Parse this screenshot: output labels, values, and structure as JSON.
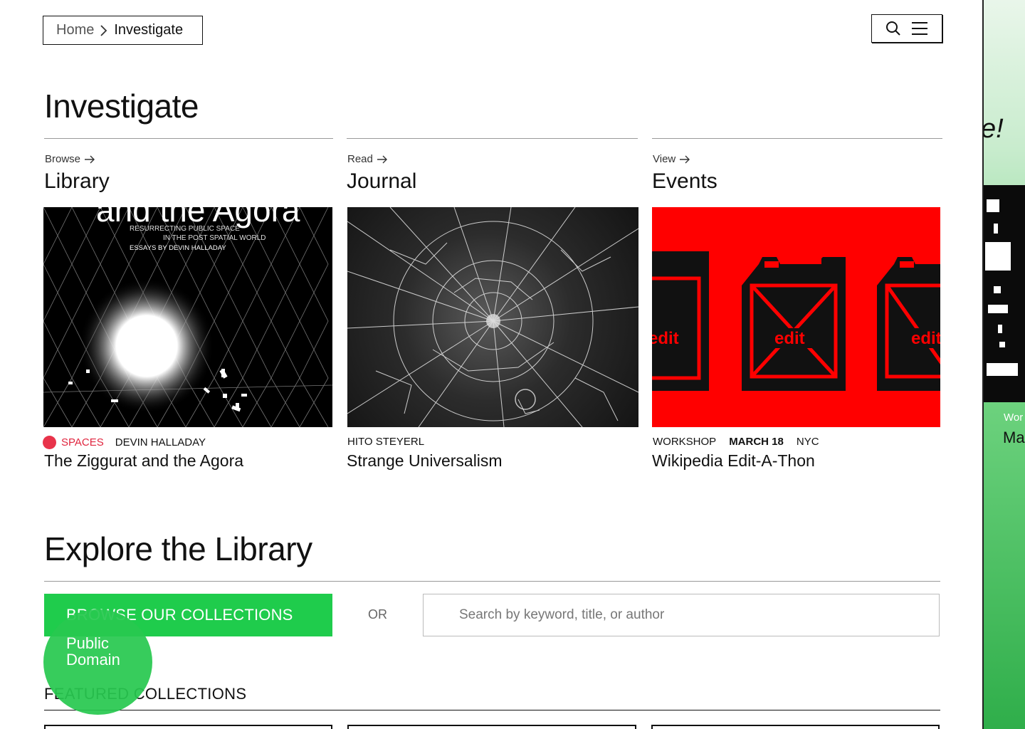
{
  "breadcrumb": {
    "home": "Home",
    "current": "Investigate"
  },
  "header": {
    "search_icon": "search-icon",
    "menu_icon": "hamburger-menu-icon"
  },
  "page_title": "Investigate",
  "columns": [
    {
      "kicker": "Browse",
      "title": "Library",
      "tag": "SPACES",
      "author": "DEVIN HALLADAY",
      "card_title": "The Ziggurat and the Agora",
      "book": {
        "heading": "and the Agora",
        "sub1": "RESURRECTING PUBLIC SPACE",
        "sub2": "IN THE POST SPATIAL WORLD",
        "sub3": "ESSAYS BY DEVIN HALLADAY"
      }
    },
    {
      "kicker": "Read",
      "title": "Journal",
      "author": "HITO STEYERL",
      "card_title": "Strange Universalism"
    },
    {
      "kicker": "View",
      "title": "Events",
      "type": "WORKSHOP",
      "date": "MARCH 18",
      "location": "NYC",
      "card_title": "Wikipedia Edit-A-Thon",
      "canister_label": "edit"
    }
  ],
  "colors": {
    "accent_green": "#1fcc4c",
    "tag_red": "#e8334a",
    "event_red": "#ff0000"
  },
  "explore": {
    "title": "Explore the Library",
    "browse_label": "BROWSE OUR COLLECTIONS",
    "or_label": "OR",
    "search_placeholder": "Search by keyword, title, or author",
    "featured_label": "FEATURED COLLECTIONS"
  },
  "badge": {
    "line1": "Public",
    "line2": "Domain"
  },
  "side_panel": {
    "headline_fragment": "e!",
    "small": "Wor",
    "large": "Ma"
  }
}
